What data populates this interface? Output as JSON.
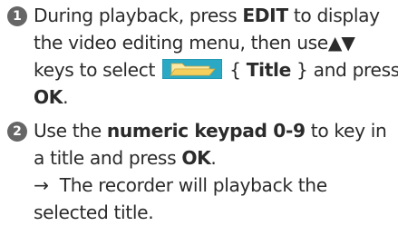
{
  "step1": {
    "number": "1",
    "line1_pre": "During playback, press ",
    "line1_bold": "EDIT",
    "line1_post": " to display",
    "line2_pre": "the video editing menu, then use",
    "line2_arrows": "▲▼",
    "line3_pre": "keys to select ",
    "line3_open": " { ",
    "line3_bold": "Title",
    "line3_close": " } and press",
    "line4_bold": "OK",
    "line4_post": ".",
    "icon": "folder-icon",
    "icon_color": "#2aa8c4"
  },
  "step2": {
    "number": "2",
    "line1_pre": "Use the ",
    "line1_bold": "numeric keypad 0-9",
    "line1_post": " to key in",
    "line2_pre": "a title and press ",
    "line2_bold": "OK",
    "line2_post": ".",
    "line3_arrow": "→",
    "line3_text": "  The recorder will playback the",
    "line4_text": "selected title."
  },
  "colors": {
    "text": "#2b2b2b",
    "badge": "#666666"
  }
}
